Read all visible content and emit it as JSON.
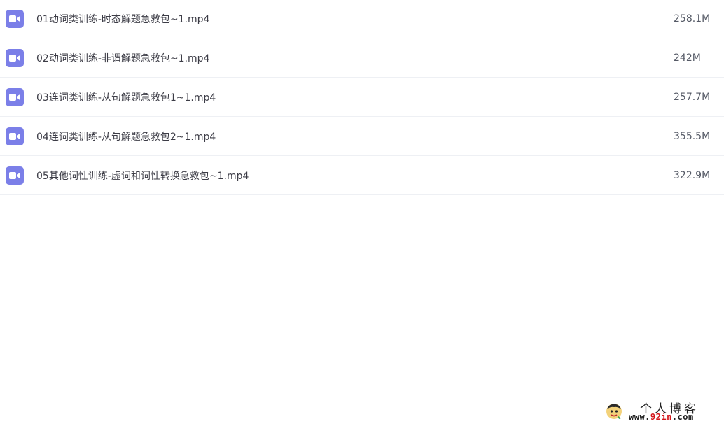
{
  "files": [
    {
      "name": "01动词类训练-时态解题急救包~1.mp4",
      "size": "258.1M",
      "icon": "video-file-icon"
    },
    {
      "name": "02动词类训练-非谓解题急救包~1.mp4",
      "size": "242M",
      "icon": "video-file-icon"
    },
    {
      "name": "03连词类训练-从句解题急救包1~1.mp4",
      "size": "257.7M",
      "icon": "video-file-icon"
    },
    {
      "name": "04连词类训练-从句解题急救包2~1.mp4",
      "size": "355.5M",
      "icon": "video-file-icon"
    },
    {
      "name": "05其他词性训练-虚词和词性转换急救包~1.mp4",
      "size": "322.9M",
      "icon": "video-file-icon"
    }
  ],
  "watermark": {
    "title": "个人博客",
    "url_prefix": "www.",
    "url_highlight": "92in",
    "url_suffix": ".com"
  },
  "colors": {
    "icon_bg": "#7b7fe8",
    "divider": "#eef0f4",
    "text": "#3c3c46",
    "url_highlight": "#d4171b"
  }
}
